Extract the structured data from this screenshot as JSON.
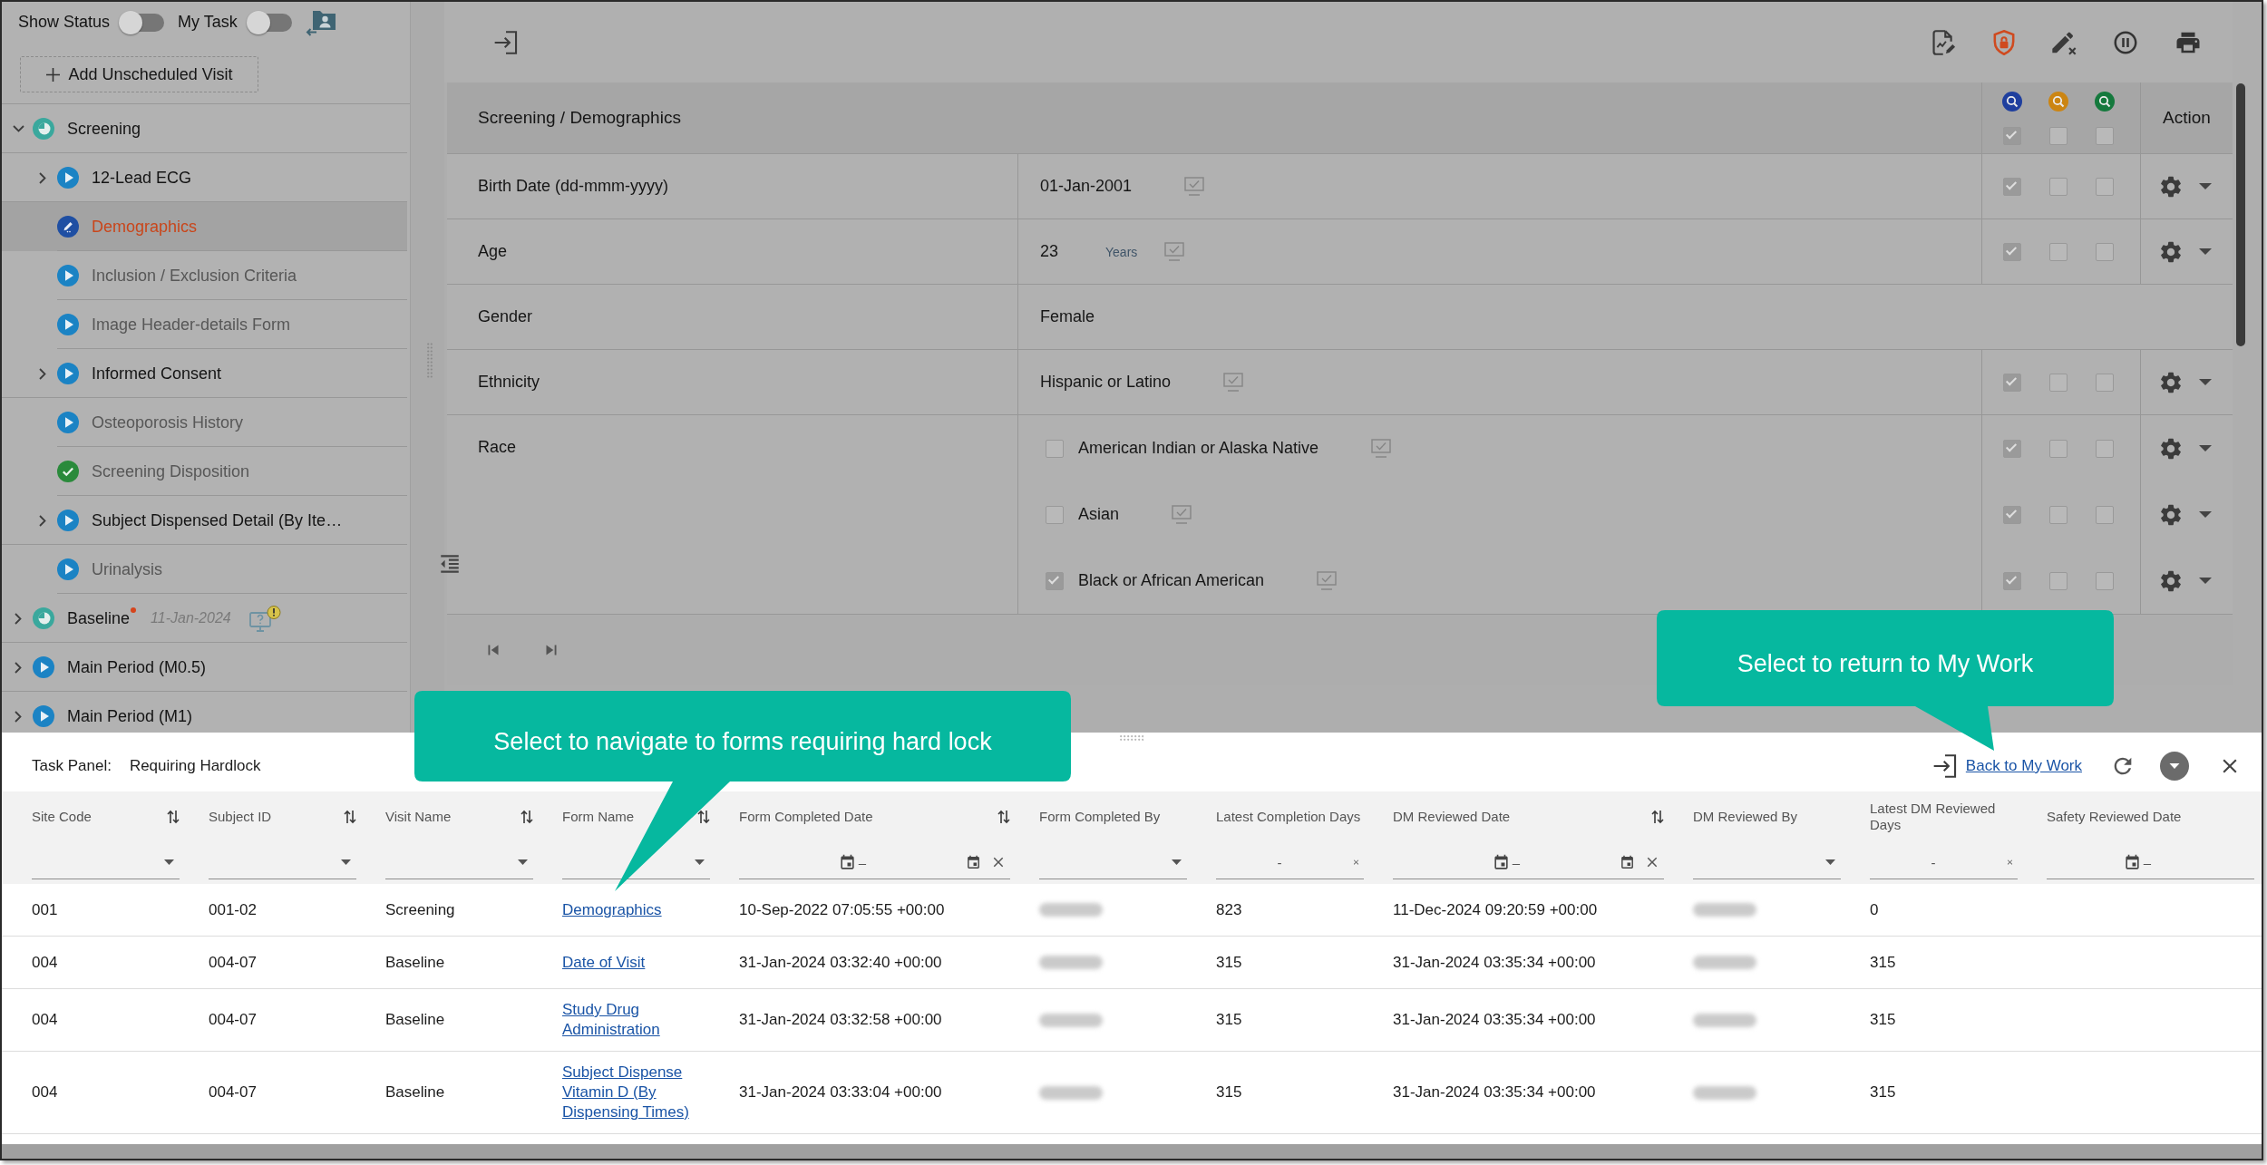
{
  "sidebar": {
    "toggles": [
      {
        "label": "Show Status",
        "on": false
      },
      {
        "label": "My Task",
        "on": false
      }
    ],
    "add_visit_button": "Add Unscheduled Visit",
    "visits": [
      {
        "label": "Screening",
        "kind": "progress",
        "expandable": true,
        "expanded": true,
        "selected": false,
        "has_update": false,
        "alert": false,
        "children": [
          {
            "label": "12-Lead ECG",
            "kind": "pending",
            "expandable": true,
            "expanded": false,
            "selected": false,
            "greyed": false
          },
          {
            "label": "Demographics",
            "kind": "editing",
            "expandable": false,
            "selected": true,
            "greyed": false
          },
          {
            "label": "Inclusion / Exclusion Criteria",
            "kind": "pending",
            "expandable": false,
            "selected": false,
            "greyed": true
          },
          {
            "label": "Image Header-details Form",
            "kind": "pending",
            "expandable": false,
            "selected": false,
            "greyed": true
          },
          {
            "label": "Informed Consent",
            "kind": "pending",
            "expandable": true,
            "expanded": false,
            "selected": false,
            "greyed": false
          },
          {
            "label": "Osteoporosis History",
            "kind": "pending",
            "expandable": false,
            "selected": false,
            "greyed": true
          },
          {
            "label": "Screening Disposition",
            "kind": "done",
            "expandable": false,
            "selected": false,
            "greyed": true
          },
          {
            "label": "Subject Dispensed Detail (By Ite…",
            "kind": "pending",
            "expandable": true,
            "expanded": false,
            "selected": false,
            "greyed": false
          },
          {
            "label": "Urinalysis",
            "kind": "pending",
            "expandable": false,
            "selected": false,
            "greyed": true
          }
        ]
      },
      {
        "label": "Baseline",
        "kind": "progress",
        "expandable": true,
        "expanded": false,
        "selected": false,
        "date": "11-Jan-2024",
        "has_update": true,
        "alert": true
      },
      {
        "label": "Main Period (M0.5)",
        "kind": "pending",
        "expandable": true,
        "expanded": false,
        "selected": false,
        "has_update": false,
        "alert": false
      },
      {
        "label": "Main Period (M1)",
        "kind": "pending",
        "expandable": true,
        "expanded": false,
        "selected": false,
        "has_update": false,
        "alert": false
      }
    ]
  },
  "form": {
    "title": "Screening / Demographics",
    "review_columns": [
      {
        "color": "#1f3f9e",
        "checked": true
      },
      {
        "color": "#cc8512",
        "checked": false
      },
      {
        "color": "#15793d",
        "checked": false
      }
    ],
    "action_header": "Action",
    "rows": [
      {
        "label": "Birth Date (dd-mmm-yyyy)",
        "lines": [
          {
            "kind": "text",
            "value": "01-Jan-2001",
            "sdv": true,
            "reviews": [
              {
                "checked": true
              },
              {
                "checked": false
              },
              {
                "checked": false
              }
            ],
            "actions": true
          }
        ]
      },
      {
        "label": "Age",
        "lines": [
          {
            "kind": "text",
            "value": "23",
            "unit": "Years",
            "sdv": true,
            "reviews": [
              {
                "checked": true
              },
              {
                "checked": false
              },
              {
                "checked": false
              }
            ],
            "actions": true
          }
        ]
      },
      {
        "label": "Gender",
        "lines": [
          {
            "kind": "text",
            "value": "Female",
            "sdv": false,
            "actions": false
          }
        ]
      },
      {
        "label": "Ethnicity",
        "lines": [
          {
            "kind": "text",
            "value": "Hispanic or Latino",
            "sdv": true,
            "reviews": [
              {
                "checked": true
              },
              {
                "checked": false
              },
              {
                "checked": false
              }
            ],
            "actions": true
          }
        ]
      },
      {
        "label": "Race",
        "lines": [
          {
            "kind": "option",
            "value": "American Indian or Alaska Native",
            "checked": false,
            "sdv": true,
            "reviews": [
              {
                "checked": true
              },
              {
                "checked": false
              },
              {
                "checked": false
              }
            ],
            "actions": true
          },
          {
            "kind": "option",
            "value": "Asian",
            "checked": false,
            "sdv": true,
            "reviews": [
              {
                "checked": true
              },
              {
                "checked": false
              },
              {
                "checked": false
              }
            ],
            "actions": true
          },
          {
            "kind": "option",
            "value": "Black or African American",
            "checked": true,
            "sdv": true,
            "reviews": [
              {
                "checked": true
              },
              {
                "checked": false
              },
              {
                "checked": false
              }
            ],
            "actions": true
          }
        ]
      }
    ]
  },
  "task_panel": {
    "title": "Task Panel:",
    "filter_name": "Requiring Hardlock",
    "back_link": "Back to My Work",
    "columns": [
      {
        "label": "Site Code",
        "sortable": true,
        "filter": {
          "kind": "select"
        }
      },
      {
        "label": "Subject ID",
        "sortable": true,
        "filter": {
          "kind": "select"
        }
      },
      {
        "label": "Visit Name",
        "sortable": true,
        "filter": {
          "kind": "select"
        }
      },
      {
        "label": "Form Name",
        "sortable": true,
        "filter": {
          "kind": "select"
        }
      },
      {
        "label": "Form Completed Date",
        "sortable": true,
        "filter": {
          "kind": "date_range",
          "separator": "–"
        }
      },
      {
        "label": "Form Completed By",
        "sortable": false,
        "filter": {
          "kind": "select"
        }
      },
      {
        "label": "Latest Completion Days",
        "sortable": false,
        "filter": {
          "kind": "number_range",
          "separator": "-"
        }
      },
      {
        "label": "DM Reviewed Date",
        "sortable": true,
        "filter": {
          "kind": "date_range",
          "separator": "–"
        }
      },
      {
        "label": "DM Reviewed By",
        "sortable": false,
        "filter": {
          "kind": "select"
        }
      },
      {
        "label": "Latest DM Reviewed Days",
        "sortable": false,
        "filter": {
          "kind": "number_range",
          "separator": "-"
        }
      },
      {
        "label": "Safety Reviewed Date",
        "sortable": false,
        "filter": {
          "kind": "date_start",
          "separator": "–"
        }
      }
    ],
    "rows": [
      {
        "cells": [
          {
            "kind": "text",
            "text": "001"
          },
          {
            "kind": "text",
            "text": "001-02"
          },
          {
            "kind": "text",
            "text": "Screening"
          },
          {
            "kind": "link",
            "text": "Demographics"
          },
          {
            "kind": "text",
            "text": "10-Sep-2022 07:05:55 +00:00"
          },
          {
            "kind": "blurred"
          },
          {
            "kind": "text",
            "text": "823"
          },
          {
            "kind": "text",
            "text": "11-Dec-2024 09:20:59 +00:00"
          },
          {
            "kind": "blurred"
          },
          {
            "kind": "text",
            "text": "0"
          }
        ]
      },
      {
        "cells": [
          {
            "kind": "text",
            "text": "004"
          },
          {
            "kind": "text",
            "text": "004-07"
          },
          {
            "kind": "text",
            "text": "Baseline"
          },
          {
            "kind": "link",
            "text": "Date of Visit"
          },
          {
            "kind": "text",
            "text": "31-Jan-2024 03:32:40 +00:00"
          },
          {
            "kind": "blurred"
          },
          {
            "kind": "text",
            "text": "315"
          },
          {
            "kind": "text",
            "text": "31-Jan-2024 03:35:34 +00:00"
          },
          {
            "kind": "blurred"
          },
          {
            "kind": "text",
            "text": "315"
          }
        ]
      },
      {
        "cells": [
          {
            "kind": "text",
            "text": "004"
          },
          {
            "kind": "text",
            "text": "004-07"
          },
          {
            "kind": "text",
            "text": "Baseline"
          },
          {
            "kind": "link",
            "text": "Study Drug Administration"
          },
          {
            "kind": "text",
            "text": "31-Jan-2024 03:32:58 +00:00"
          },
          {
            "kind": "blurred"
          },
          {
            "kind": "text",
            "text": "315"
          },
          {
            "kind": "text",
            "text": "31-Jan-2024 03:35:34 +00:00"
          },
          {
            "kind": "blurred"
          },
          {
            "kind": "text",
            "text": "315"
          }
        ]
      },
      {
        "cells": [
          {
            "kind": "text",
            "text": "004"
          },
          {
            "kind": "text",
            "text": "004-07"
          },
          {
            "kind": "text",
            "text": "Baseline"
          },
          {
            "kind": "link",
            "text": "Subject Dispense Vitamin D (By Dispensing Times)"
          },
          {
            "kind": "text",
            "text": "31-Jan-2024 03:33:04 +00:00"
          },
          {
            "kind": "blurred"
          },
          {
            "kind": "text",
            "text": "315"
          },
          {
            "kind": "text",
            "text": "31-Jan-2024 03:35:34 +00:00"
          },
          {
            "kind": "blurred"
          },
          {
            "kind": "text",
            "text": "315"
          }
        ]
      }
    ]
  },
  "callouts": [
    {
      "text": "Select to navigate to forms requiring hard lock"
    },
    {
      "text": "Select to return to My Work"
    }
  ]
}
